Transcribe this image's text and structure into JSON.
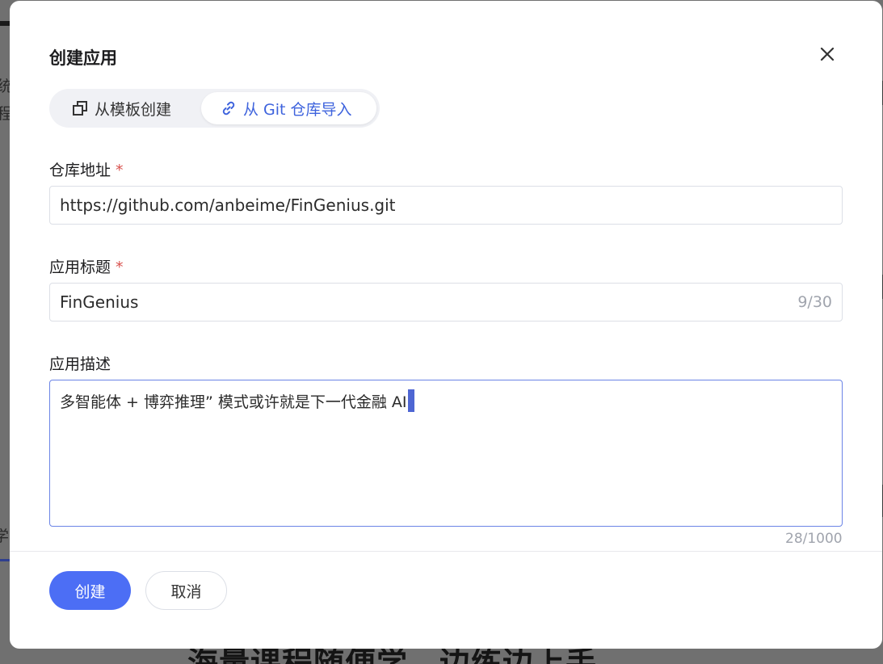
{
  "background": {
    "fragments": [
      "统",
      "程",
      "学"
    ],
    "headline": "海量课程随便学，边练边上手"
  },
  "dialog": {
    "title": "创建应用",
    "tabs": [
      {
        "label": "从模板创建",
        "icon": "copy-icon",
        "active": false
      },
      {
        "label": "从 Git 仓库导入",
        "icon": "link-icon",
        "active": true
      }
    ],
    "repo": {
      "label": "仓库地址",
      "required_mark": "*",
      "value": "https://github.com/anbeime/FinGenius.git"
    },
    "app_title": {
      "label": "应用标题",
      "required_mark": "*",
      "value": "FinGenius",
      "count": "9/30"
    },
    "description": {
      "label": "应用描述",
      "value": "多智能体 + 博弈推理”  模式或许就是下一代金融 AI",
      "count": "28/1000"
    },
    "buttons": {
      "create": "创建",
      "cancel": "取消"
    }
  },
  "colors": {
    "accent": "#4c6ef5",
    "active_tab_text": "#3e63dd",
    "required": "#d9534f",
    "focus_border": "#6b84e6"
  }
}
